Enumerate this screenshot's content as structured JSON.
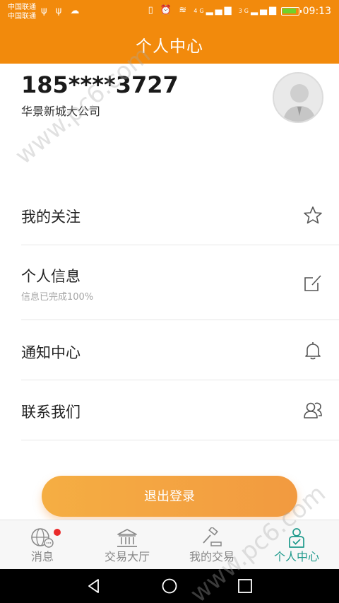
{
  "status": {
    "carrier_1": "中国联通",
    "carrier_2": "中国联通",
    "time": "09:13",
    "network_1": "4G",
    "network_2": "3G"
  },
  "header": {
    "title": "个人中心"
  },
  "profile": {
    "phone": "185****3727",
    "company": "华景新城大公司"
  },
  "menu": {
    "items": [
      {
        "label": "我的关注",
        "icon": "star-icon"
      },
      {
        "label": "个人信息",
        "sub": "信息已完成100%",
        "icon": "edit-icon"
      },
      {
        "label": "通知中心",
        "icon": "bell-icon"
      },
      {
        "label": "联系我们",
        "icon": "contacts-icon"
      }
    ]
  },
  "logout_label": "退出登录",
  "tabs": [
    {
      "label": "消息",
      "icon": "message-globe-icon"
    },
    {
      "label": "交易大厅",
      "icon": "bank-icon"
    },
    {
      "label": "我的交易",
      "icon": "auction-hammer-icon"
    },
    {
      "label": "个人中心",
      "icon": "person-icon",
      "active": true
    }
  ],
  "watermark": "www.pc6.com",
  "colors": {
    "header": "#f28a0c",
    "accent_tab": "#1f9a8c",
    "logout_start": "#f5ae43",
    "logout_end": "#f29a40",
    "badge": "#ea2b2b"
  }
}
